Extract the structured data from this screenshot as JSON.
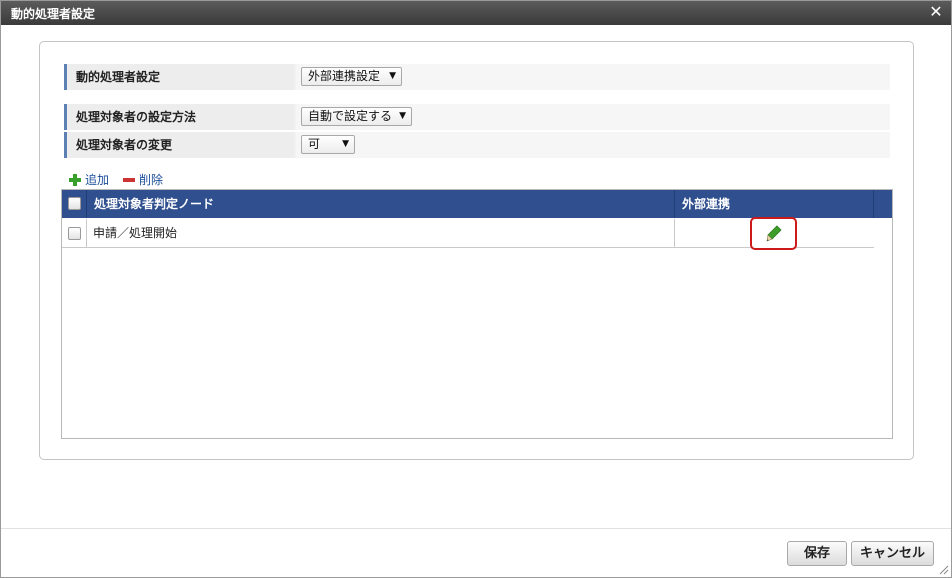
{
  "dialog": {
    "title": "動的処理者設定",
    "close_icon": "close-icon"
  },
  "form": {
    "row1": {
      "label": "動的処理者設定",
      "select_value": "外部連携設定"
    },
    "row2": {
      "label": "処理対象者の設定方法",
      "select_value": "自動で設定する"
    },
    "row3": {
      "label": "処理対象者の変更",
      "select_value": "可"
    }
  },
  "toolbar": {
    "add_label": "追加",
    "add_icon": "plus-icon",
    "delete_label": "削除",
    "delete_icon": "minus-icon"
  },
  "grid": {
    "columns": [
      "処理対象者判定ノード",
      "外部連携"
    ],
    "rows": [
      {
        "node": "申請／処理開始",
        "action_icon": "pencil-icon"
      }
    ]
  },
  "footer": {
    "save_label": "保存",
    "cancel_label": "キャンセル"
  },
  "colors": {
    "header_bg": "#2f4f8f",
    "highlight_border": "#cc1a1a",
    "add_icon": "#3aa02c",
    "delete_icon": "#cc3333"
  }
}
